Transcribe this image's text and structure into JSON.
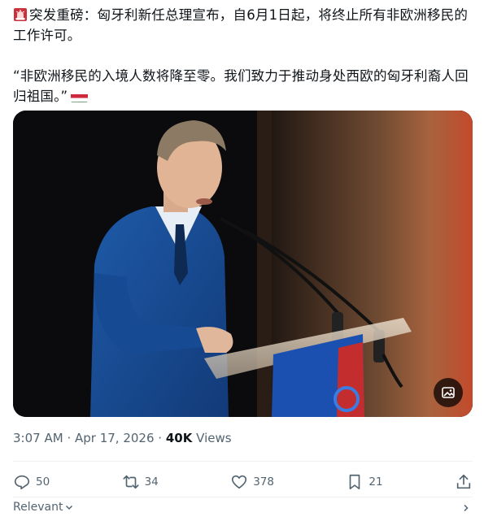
{
  "tweet": {
    "line1": "突发重磅：匈牙利新任总理宣布，自6月1日起，将终止所有非欧洲移民的工作许可。",
    "line2": "“非欧洲移民的入境人数将降至零。我们致力于推动身处西欧的匈牙利裔人回归祖国。”",
    "leading_icon": "rotating-light-icon",
    "trailing_icon": "hungary-flag-icon"
  },
  "media": {
    "alt_button_icon": "image-description-icon"
  },
  "meta": {
    "time": "3:07 AM",
    "separator": "·",
    "date": "Apr 17, 2026",
    "views_count": "40K",
    "views_label": "Views"
  },
  "actions": {
    "replies": "50",
    "reposts": "34",
    "likes": "378",
    "bookmarks": "21"
  },
  "replies_sort": {
    "label": "Relevant"
  },
  "colors": {
    "text": "#0f1419",
    "muted": "#536471",
    "flag_red": "#cd2a3e",
    "flag_green": "#436f4d"
  }
}
